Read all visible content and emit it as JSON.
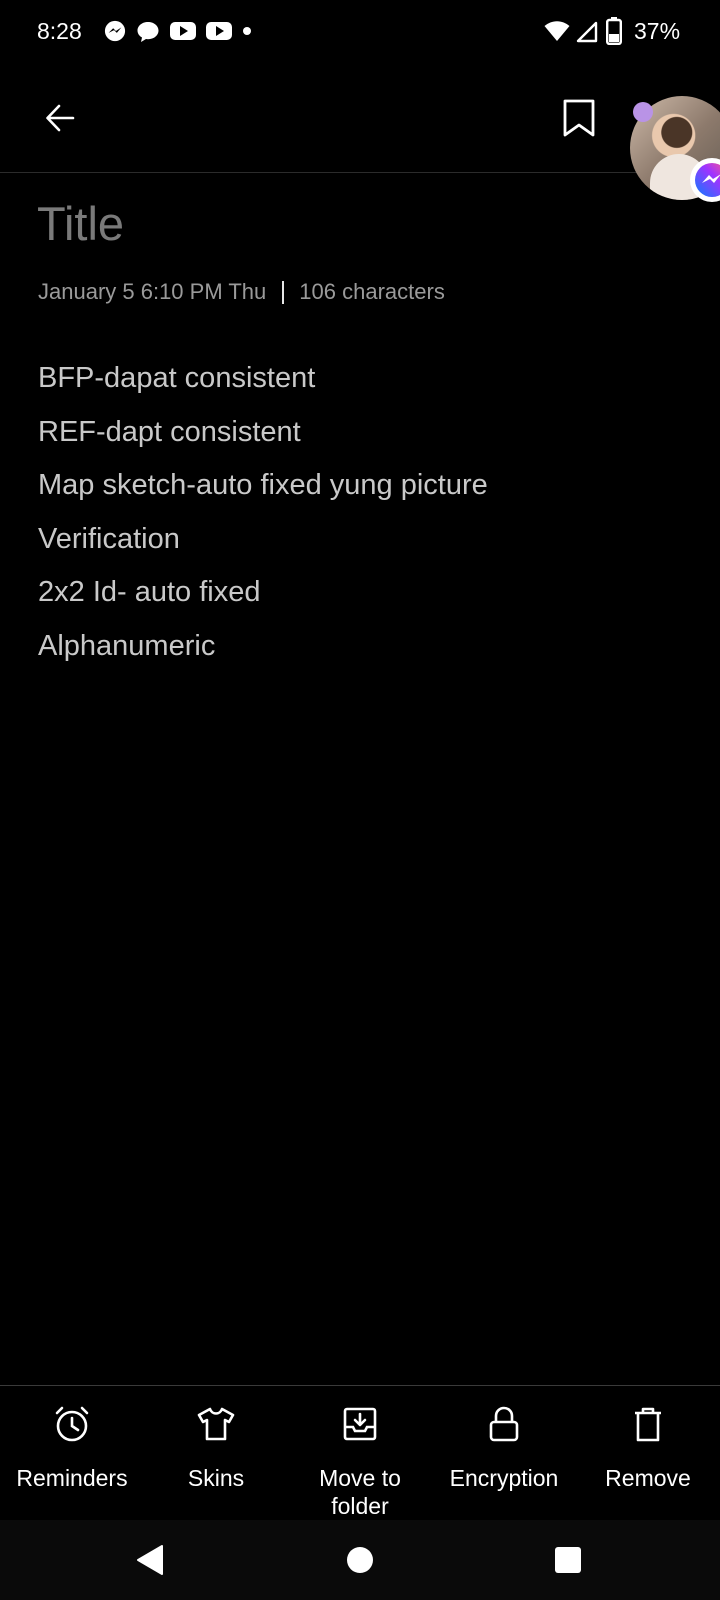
{
  "status_bar": {
    "time": "8:28",
    "battery_percent": "37%",
    "notification_icons": [
      "messenger-icon",
      "chat-bubble-icon",
      "youtube-icon",
      "youtube-icon",
      "more-dot-icon"
    ],
    "system_icons": [
      "wifi-icon",
      "signal-icon",
      "battery-icon"
    ]
  },
  "toolbar": {
    "back_icon": "arrow-left-icon",
    "bookmark_icon": "bookmark-icon"
  },
  "chat_head": {
    "app": "messenger",
    "unread_dot_color": "#b993e6"
  },
  "note": {
    "title_placeholder": "Title",
    "date": "January 5 6:10 PM Thu",
    "char_count": "106 characters",
    "lines": [
      "BFP-dapat consistent",
      "REF-dapt consistent",
      "Map sketch-auto fixed yung picture",
      "Verification",
      "2x2 Id- auto fixed",
      "Alphanumeric"
    ]
  },
  "actions": [
    {
      "label": "Reminders",
      "icon": "alarm-clock-icon"
    },
    {
      "label": "Skins",
      "icon": "tshirt-icon"
    },
    {
      "label": "Move to folder",
      "icon": "move-to-folder-icon"
    },
    {
      "label": "Encryption",
      "icon": "lock-icon"
    },
    {
      "label": "Remove",
      "icon": "trash-icon"
    }
  ],
  "nav_bar": {
    "buttons": [
      "back-triangle-icon",
      "home-circle-icon",
      "recents-square-icon"
    ]
  },
  "colors": {
    "background": "#000000",
    "title_placeholder": "#7a7a7a",
    "meta_text": "#9a9a9a",
    "body_text": "#c9c9c9"
  }
}
